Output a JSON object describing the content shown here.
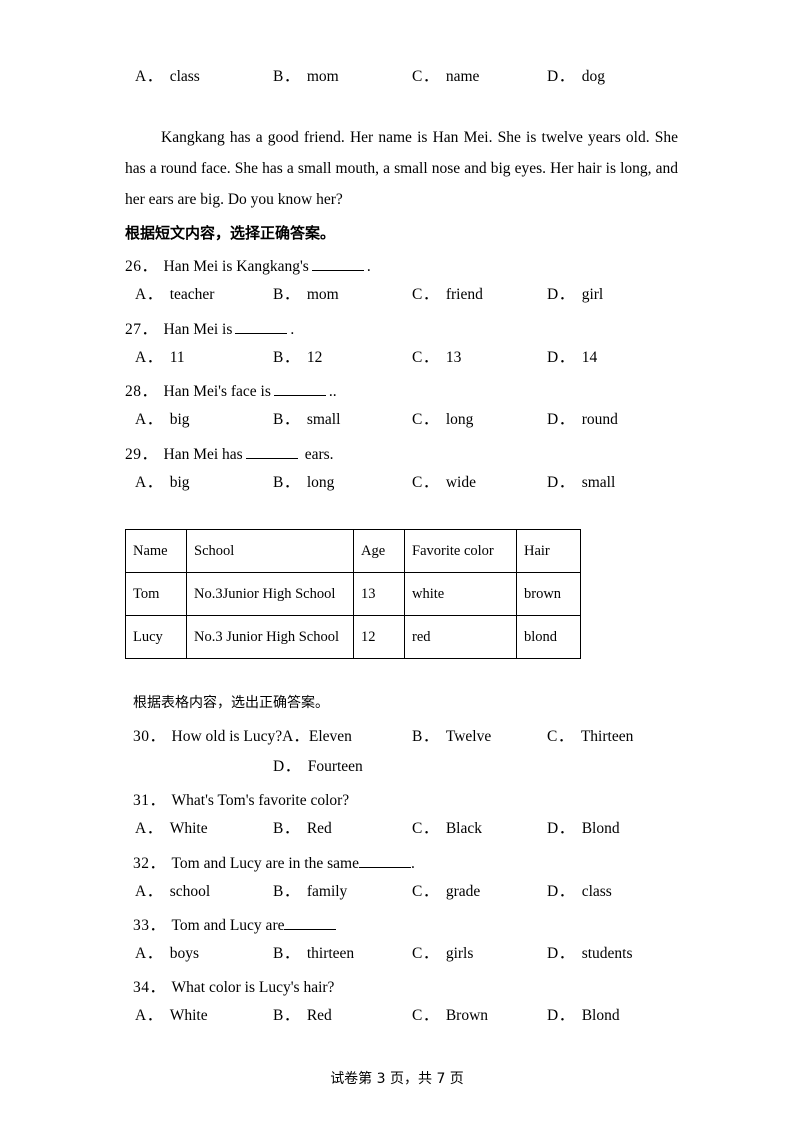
{
  "document": {
    "page_footer": "试卷第 3 页，共 7 页"
  },
  "top_options": {
    "labels": [
      "A．",
      "B．",
      "C．",
      "D．"
    ],
    "values": [
      "class",
      "mom",
      "name",
      "dog"
    ]
  },
  "passage": {
    "text": "Kangkang has a good friend. Her name is Han Mei. She is twelve years old. She has a round face. She has a small mouth, a small nose and big eyes. Her hair is long, and her ears are big. Do you know her?"
  },
  "section_1": {
    "heading": "根据短文内容，选择正确答案。",
    "questions": [
      {
        "num": "26．",
        "stem_before": "Han Mei is Kangkang's",
        "stem_after": ".",
        "blank": "with-space",
        "options": {
          "labels": [
            "A．",
            "B．",
            "C．",
            "D．"
          ],
          "values": [
            "teacher",
            "mom",
            "friend",
            "girl"
          ]
        }
      },
      {
        "num": "27．",
        "stem_before": "Han Mei is",
        "stem_after": ".",
        "blank": "with-space",
        "options": {
          "labels": [
            "A．",
            "B．",
            "C．",
            "D．"
          ],
          "values": [
            "11",
            "12",
            "13",
            "14"
          ]
        }
      },
      {
        "num": "28．",
        "stem_before": "Han Mei's face is",
        "stem_after": "..",
        "blank": "with-space",
        "options": {
          "labels": [
            "A．",
            "B．",
            "C．",
            "D．"
          ],
          "values": [
            "big",
            "small",
            "long",
            "round"
          ]
        }
      },
      {
        "num": "29．",
        "stem_before": "Han Mei has",
        "stem_after": "ears.",
        "blank": "with-space",
        "options": {
          "labels": [
            "A．",
            "B．",
            "C．",
            "D．"
          ],
          "values": [
            "big",
            "long",
            "wide",
            "small"
          ]
        }
      }
    ]
  },
  "table": {
    "headers": [
      "Name",
      "School",
      "Age",
      "Favorite color",
      "Hair"
    ],
    "rows": [
      [
        "Tom",
        "No.3Junior High School",
        "13",
        "white",
        "brown"
      ],
      [
        "Lucy",
        "No.3 Junior High School",
        "12",
        "red",
        "blond"
      ]
    ]
  },
  "section_2": {
    "heading": "根据表格内容，选出正确答案。",
    "question_30": {
      "num": "30．",
      "stem": "How old is Lucy?",
      "inline_label": "A．",
      "inline_value": "Eleven",
      "option_b_label": "B．",
      "option_b_value": "Twelve",
      "option_c_label": "C．",
      "option_c_value": "Thirteen",
      "option_d_label": "D．",
      "option_d_value": "Fourteen"
    },
    "questions": [
      {
        "num": "31．",
        "stem_before": "What's Tom's favorite color?",
        "stem_after": "",
        "blank": "none",
        "options": {
          "labels": [
            "A．",
            "B．",
            "C．",
            "D．"
          ],
          "values": [
            "White",
            "Red",
            "Black",
            "Blond"
          ]
        }
      },
      {
        "num": "32．",
        "stem_before": "Tom and Lucy are in the same",
        "stem_after": ".",
        "blank": "tight",
        "options": {
          "labels": [
            "A．",
            "B．",
            "C．",
            "D．"
          ],
          "values": [
            "school",
            "family",
            "grade",
            "class"
          ]
        }
      },
      {
        "num": "33．",
        "stem_before": "Tom and Lucy are",
        "stem_after": "",
        "blank": "tight",
        "options": {
          "labels": [
            "A．",
            "B．",
            "C．",
            "D．"
          ],
          "values": [
            "boys",
            "thirteen",
            "girls",
            "students"
          ]
        }
      },
      {
        "num": "34．",
        "stem_before": "What color is Lucy's hair?",
        "stem_after": "",
        "blank": "none",
        "options": {
          "labels": [
            "A．",
            "B．",
            "C．",
            "D．"
          ],
          "values": [
            "White",
            "Red",
            "Brown",
            "Blond"
          ]
        }
      }
    ]
  }
}
